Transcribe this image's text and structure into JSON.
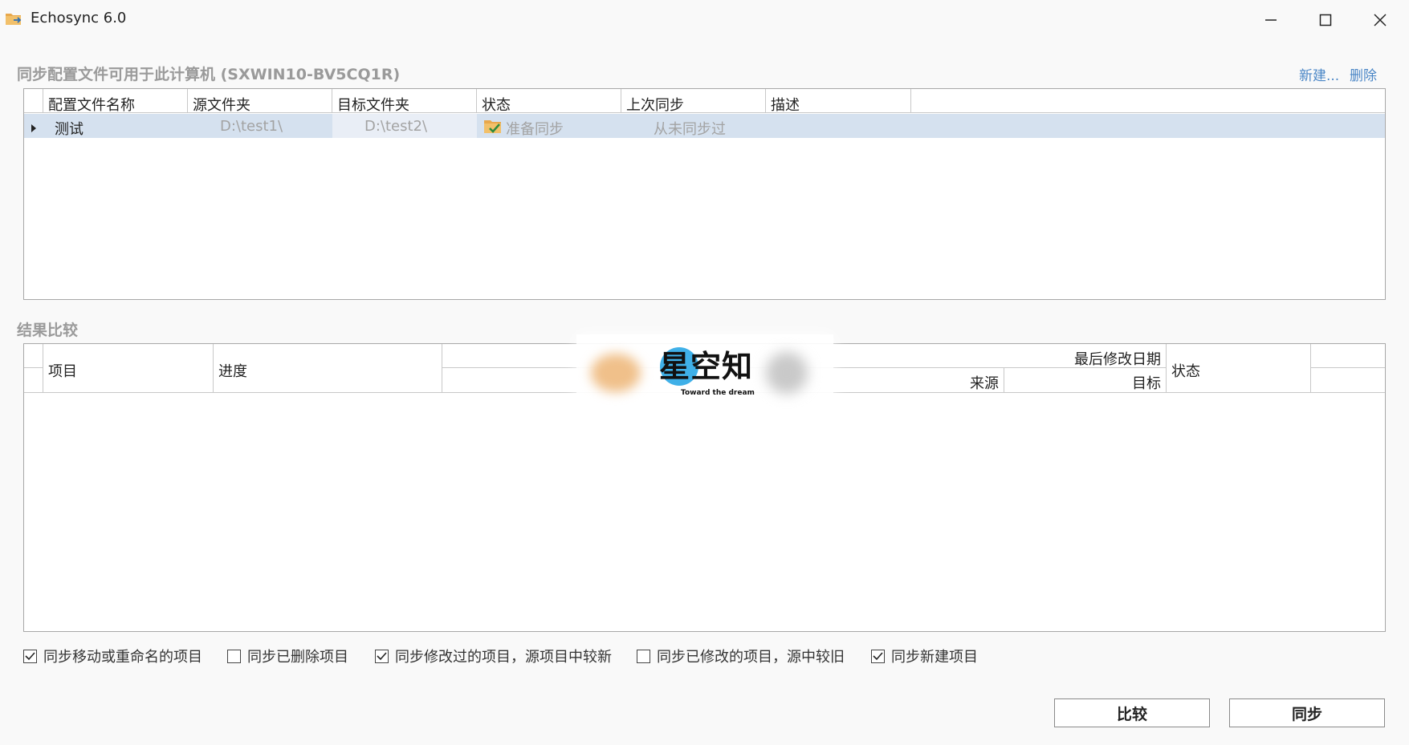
{
  "window": {
    "title": "Echosync 6.0"
  },
  "profiles": {
    "label": "同步配置文件可用于此计算机 (SXWIN10-BV5CQ1R)",
    "new_link": "新建...",
    "delete_link": "删除",
    "columns": [
      "配置文件名称",
      "源文件夹",
      "目标文件夹",
      "状态",
      "上次同步",
      "描述"
    ],
    "rows": [
      {
        "name": "测试",
        "source": "D:\\test1\\",
        "target": "D:\\test2\\",
        "status": "准备同步",
        "last_sync": "从未同步过",
        "description": ""
      }
    ]
  },
  "results": {
    "label": "结果比较",
    "columns": {
      "item": "项目",
      "progress": "进度",
      "modified_date": "最后修改日期",
      "source": "来源",
      "target": "目标",
      "status": "状态"
    }
  },
  "watermark": {
    "main": "星空知",
    "sub": "Toward the dream"
  },
  "options": [
    {
      "label": "同步移动或重命名的项目",
      "checked": true
    },
    {
      "label": "同步已删除项目",
      "checked": false
    },
    {
      "label": "同步修改过的项目，源项目中较新",
      "checked": true
    },
    {
      "label": "同步已修改的项目，源中较旧",
      "checked": false
    },
    {
      "label": "同步新建项目",
      "checked": true
    }
  ],
  "buttons": {
    "compare": "比较",
    "sync": "同步"
  },
  "colors": {
    "selected_row": "#d5e1ef",
    "link": "#4a86c6",
    "muted_text": "#a3a3a3"
  }
}
